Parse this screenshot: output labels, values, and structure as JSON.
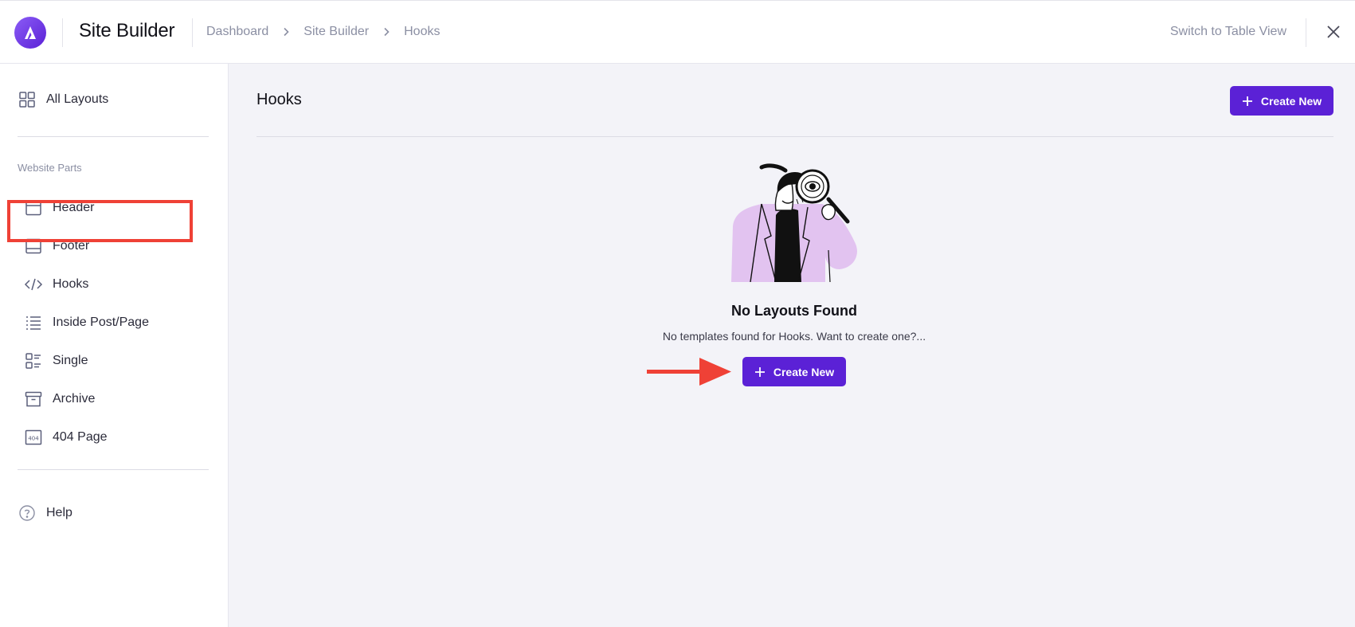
{
  "app": {
    "title": "Site Builder",
    "logo_icon": "astra-logo-icon",
    "accent_color": "#5b21d6"
  },
  "breadcrumb": [
    "Dashboard",
    "Site Builder",
    "Hooks"
  ],
  "topbar": {
    "switch_view_label": "Switch to Table View",
    "close_icon": "close-icon"
  },
  "sidebar": {
    "all_layouts": {
      "label": "All Layouts",
      "icon": "grid-icon"
    },
    "section_label": "Website Parts",
    "items": [
      {
        "label": "Header",
        "icon": "header-layout-icon"
      },
      {
        "label": "Footer",
        "icon": "footer-layout-icon"
      },
      {
        "label": "Hooks",
        "icon": "code-icon"
      },
      {
        "label": "Inside Post/Page",
        "icon": "list-icon"
      },
      {
        "label": "Single",
        "icon": "single-layout-icon"
      },
      {
        "label": "Archive",
        "icon": "archive-box-icon"
      },
      {
        "label": "404 Page",
        "icon": "404-icon"
      }
    ],
    "help": {
      "label": "Help",
      "icon": "help-circle-icon"
    },
    "highlight_color": "#ef4136"
  },
  "main": {
    "title": "Hooks",
    "create_new_label": "Create New",
    "empty_state": {
      "title": "No Layouts Found",
      "subtitle": "No templates found for Hooks. Want to create one?...",
      "button_label": "Create New",
      "illustration": "magnifying-glass-person-illustration"
    }
  }
}
